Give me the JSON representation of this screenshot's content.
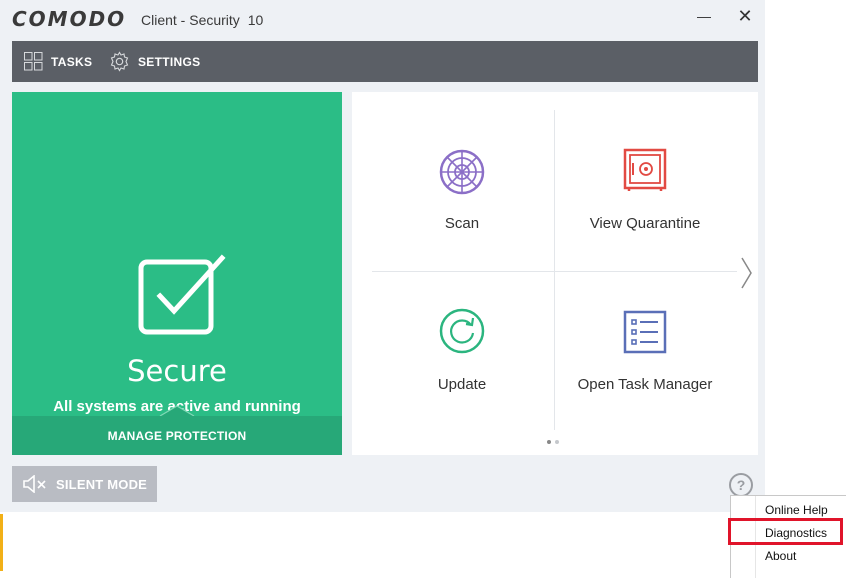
{
  "window": {
    "brand": "COMODO",
    "product_name": "Client - Security",
    "product_version": "10",
    "minimize_symbol": "—",
    "close_symbol": "✕"
  },
  "toolbar": {
    "tasks_label": "TASKS",
    "settings_label": "SETTINGS"
  },
  "status": {
    "title": "Secure",
    "subtitle": "All systems are active and running",
    "manage_label": "MANAGE PROTECTION",
    "color": "#2bbd86"
  },
  "tiles": [
    {
      "label": "Scan",
      "icon": "scan-radar-icon",
      "color": "#8b6fc7"
    },
    {
      "label": "View Quarantine",
      "icon": "quarantine-vault-icon",
      "color": "#e24a43"
    },
    {
      "label": "Update",
      "icon": "update-refresh-icon",
      "color": "#2bb57f"
    },
    {
      "label": "Open Task Manager",
      "icon": "task-list-icon",
      "color": "#5a6fb7"
    }
  ],
  "pager": {
    "pages": 2,
    "current": 1
  },
  "silent_mode": {
    "label": "SILENT MODE"
  },
  "help": {
    "symbol": "?"
  },
  "help_menu": {
    "items": [
      "Online Help",
      "Diagnostics",
      "About"
    ],
    "highlighted": "Diagnostics"
  }
}
